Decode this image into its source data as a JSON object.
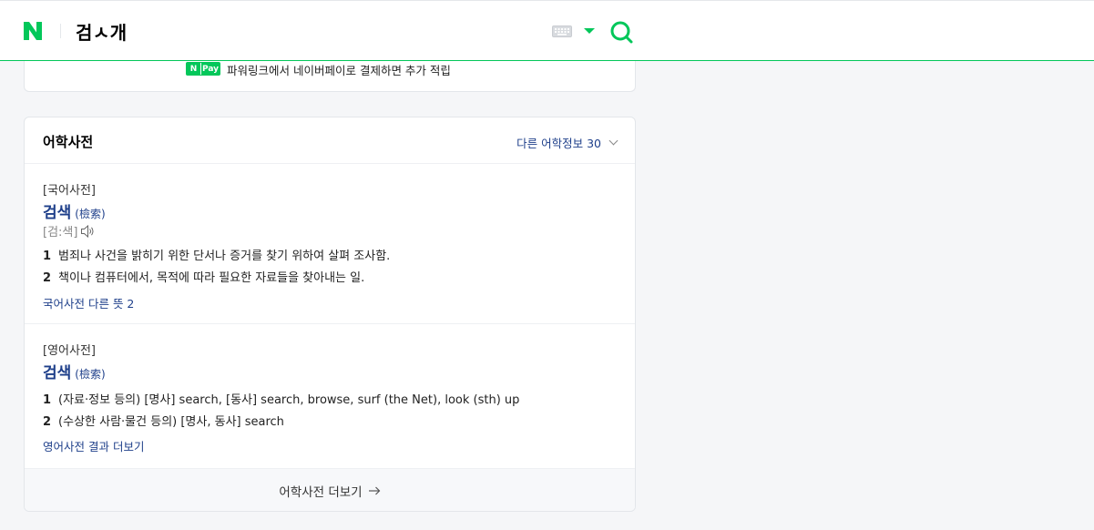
{
  "header": {
    "logo": "N",
    "query": "검ㅅ개",
    "keyboard_icon": "keyboard-icon",
    "search_icon": "search-icon"
  },
  "npay": {
    "badge_n": "N",
    "badge_pay": "Pay",
    "text": "파워링크에서 네이버페이로 결제하면 추가 적립"
  },
  "dictionary": {
    "title": "어학사전",
    "other_info": "다른 어학정보 30",
    "korean": {
      "source": "[국어사전]",
      "word": "검색",
      "hanja": "(檢索)",
      "pronunciation": "[검:색]",
      "definitions": [
        {
          "num": "1",
          "text": "범죄나 사건을 밝히기 위한 단서나 증거를 찾기 위하여 살펴 조사함."
        },
        {
          "num": "2",
          "text": "책이나 컴퓨터에서, 목적에 따라 필요한 자료들을 찾아내는 일."
        }
      ],
      "more": "국어사전 다른 뜻 2"
    },
    "english": {
      "source": "[영어사전]",
      "word": "검색",
      "hanja": "(檢索)",
      "definitions": [
        {
          "num": "1",
          "text": "(자료·정보 등의) [명사] search, [동사] search, browse, surf (the Net), look (sth) up"
        },
        {
          "num": "2",
          "text": "(수상한 사람·물건 등의) [명사, 동사] search"
        }
      ],
      "more": "영어사전 결과 더보기"
    },
    "footer": "어학사전 더보기"
  },
  "colors": {
    "brand": "#03c75a",
    "link": "#1e3f8a"
  }
}
